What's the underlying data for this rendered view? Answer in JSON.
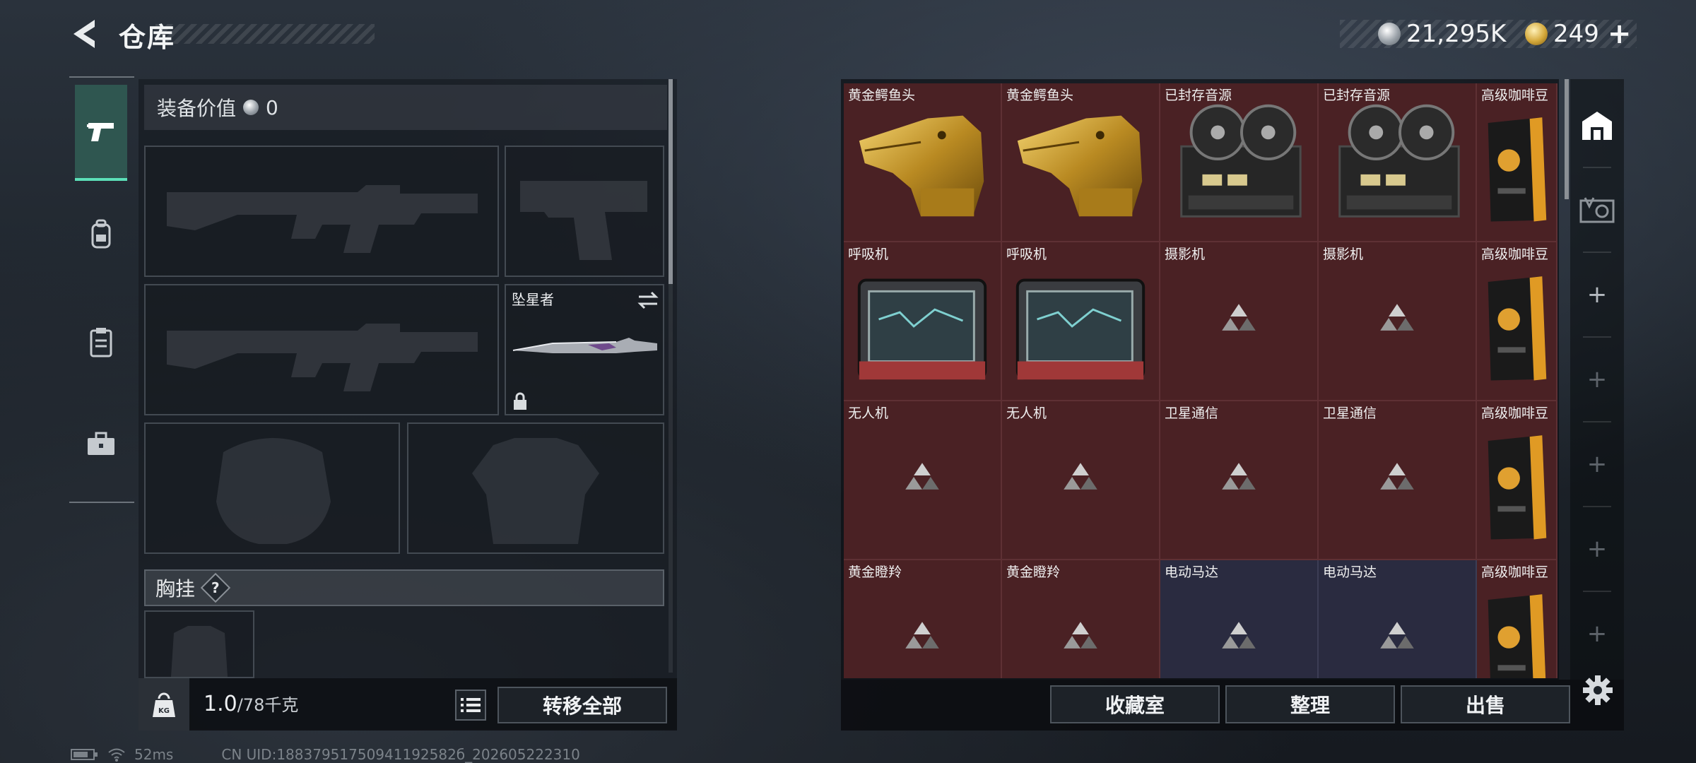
{
  "header": {
    "title": "仓库",
    "currencies": [
      {
        "icon": "silver-coin-icon",
        "value": "21,295K"
      },
      {
        "icon": "gold-coin-icon",
        "value": "249"
      }
    ],
    "add_currency_label": "+"
  },
  "tabs": [
    {
      "icon": "pistol-icon",
      "active": true
    },
    {
      "icon": "backpack-icon",
      "active": false
    },
    {
      "icon": "clipboard-icon",
      "active": false
    },
    {
      "icon": "toolbox-icon",
      "active": false
    }
  ],
  "equipment": {
    "value_label": "装备价值",
    "value": "0",
    "melee_slot": {
      "name": "坠星者"
    },
    "chest_rig_label": "胸挂",
    "help_label": "?"
  },
  "weight": {
    "icon_label": "KG",
    "current": "1.0",
    "capacity": "/78千克"
  },
  "buttons": {
    "transfer_all": "转移全部",
    "collection_room": "收藏室",
    "sort": "整理",
    "sell": "出售"
  },
  "stash": {
    "rows": [
      [
        {
          "name": "黄金鳄鱼头",
          "art": "croc",
          "tint": "red"
        },
        {
          "name": "黄金鳄鱼头",
          "art": "croc",
          "tint": "red"
        },
        {
          "name": "已封存音源",
          "art": "reel",
          "tint": "red"
        },
        {
          "name": "已封存音源",
          "art": "reel",
          "tint": "red"
        },
        {
          "name": "高级咖啡豆",
          "art": "coffee",
          "tint": "red"
        }
      ],
      [
        {
          "name": "呼吸机",
          "art": "ventilator",
          "tint": "red"
        },
        {
          "name": "呼吸机",
          "art": "ventilator",
          "tint": "red"
        },
        {
          "name": "摄影机",
          "art": "loading",
          "tint": "red"
        },
        {
          "name": "摄影机",
          "art": "loading",
          "tint": "red"
        },
        {
          "name": "高级咖啡豆",
          "art": "coffee",
          "tint": "red"
        }
      ],
      [
        {
          "name": "无人机",
          "art": "loading",
          "tint": "red"
        },
        {
          "name": "无人机",
          "art": "loading",
          "tint": "red"
        },
        {
          "name": "卫星通信",
          "art": "loading",
          "tint": "red"
        },
        {
          "name": "卫星通信",
          "art": "loading",
          "tint": "red"
        },
        {
          "name": "高级咖啡豆",
          "art": "coffee",
          "tint": "red"
        }
      ],
      [
        {
          "name": "黄金瞪羚",
          "art": "loading",
          "tint": "red"
        },
        {
          "name": "黄金瞪羚",
          "art": "loading",
          "tint": "red"
        },
        {
          "name": "电动马达",
          "art": "loading",
          "tint": "blue"
        },
        {
          "name": "电动马达",
          "art": "loading",
          "tint": "blue"
        },
        {
          "name": "高级咖啡豆",
          "art": "coffee",
          "tint": "red"
        }
      ]
    ]
  },
  "rail": {
    "plus_label": "+"
  },
  "status": {
    "ping": "52ms",
    "uid": "CN UID:18837951750941192582б_202605222310"
  },
  "colors": {
    "accent": "#5ce0b8",
    "cell_red": "#4a2124",
    "cell_blue": "#2a2b40"
  }
}
